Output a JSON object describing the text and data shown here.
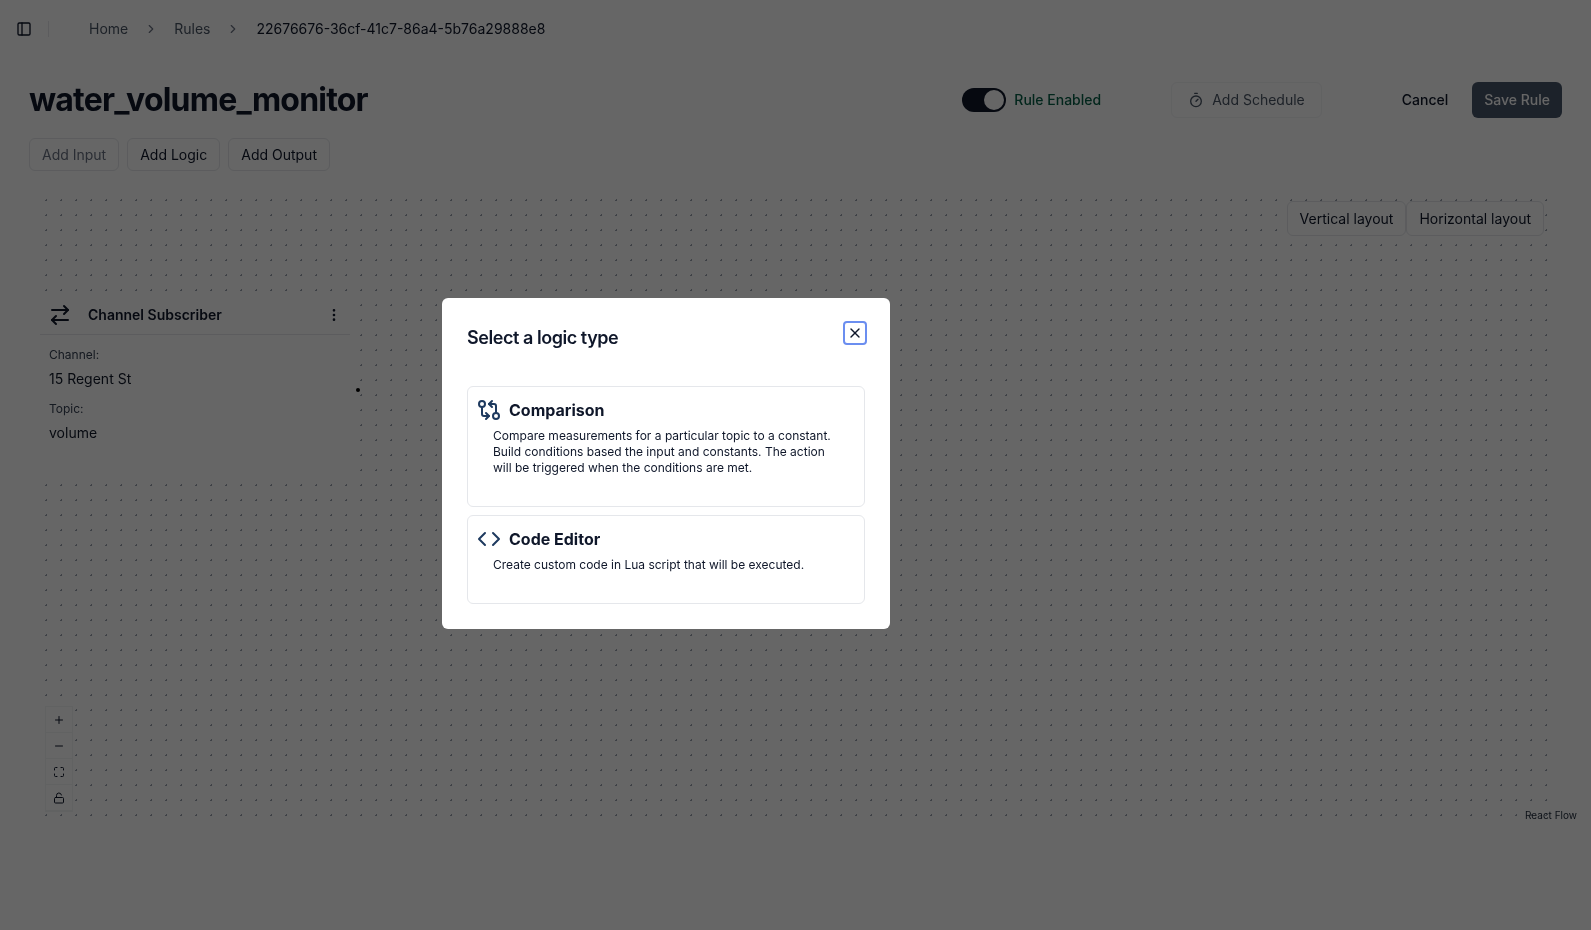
{
  "breadcrumbs": [
    {
      "label": "Home",
      "current": false
    },
    {
      "label": "Rules",
      "current": false
    },
    {
      "label": "22676676-36cf-41c7-86a4-5b76a29888e8",
      "current": true
    }
  ],
  "title": "water_volume_monitor",
  "rule_toggle": {
    "label": "Rule Enabled",
    "on": true
  },
  "schedule_button": {
    "label": "Add Schedule"
  },
  "cancel_button": {
    "label": "Cancel"
  },
  "save_button": {
    "label": "Save Rule",
    "disabled": true
  },
  "add_buttons": [
    {
      "label": "Add Input",
      "disabled": true
    },
    {
      "label": "Add Logic",
      "disabled": false
    },
    {
      "label": "Add Output",
      "disabled": false
    }
  ],
  "layout_buttons": [
    "Vertical layout",
    "Horizontal layout"
  ],
  "node": {
    "title": "Channel Subscriber",
    "fields": [
      {
        "label": "Channel:",
        "value": "15 Regent St"
      },
      {
        "label": "Topic:",
        "value": "volume"
      }
    ]
  },
  "attribution": "React Flow",
  "dialog": {
    "title": "Select a logic type",
    "options": [
      {
        "kind": "comparison",
        "title": "Comparison",
        "description": "Compare measurements for a particular topic to a constant. Build conditions based the input and constants. The action will be triggered when the conditions are met."
      },
      {
        "kind": "code",
        "title": "Code Editor",
        "description": "Create custom code in Lua script that will be executed."
      }
    ]
  }
}
